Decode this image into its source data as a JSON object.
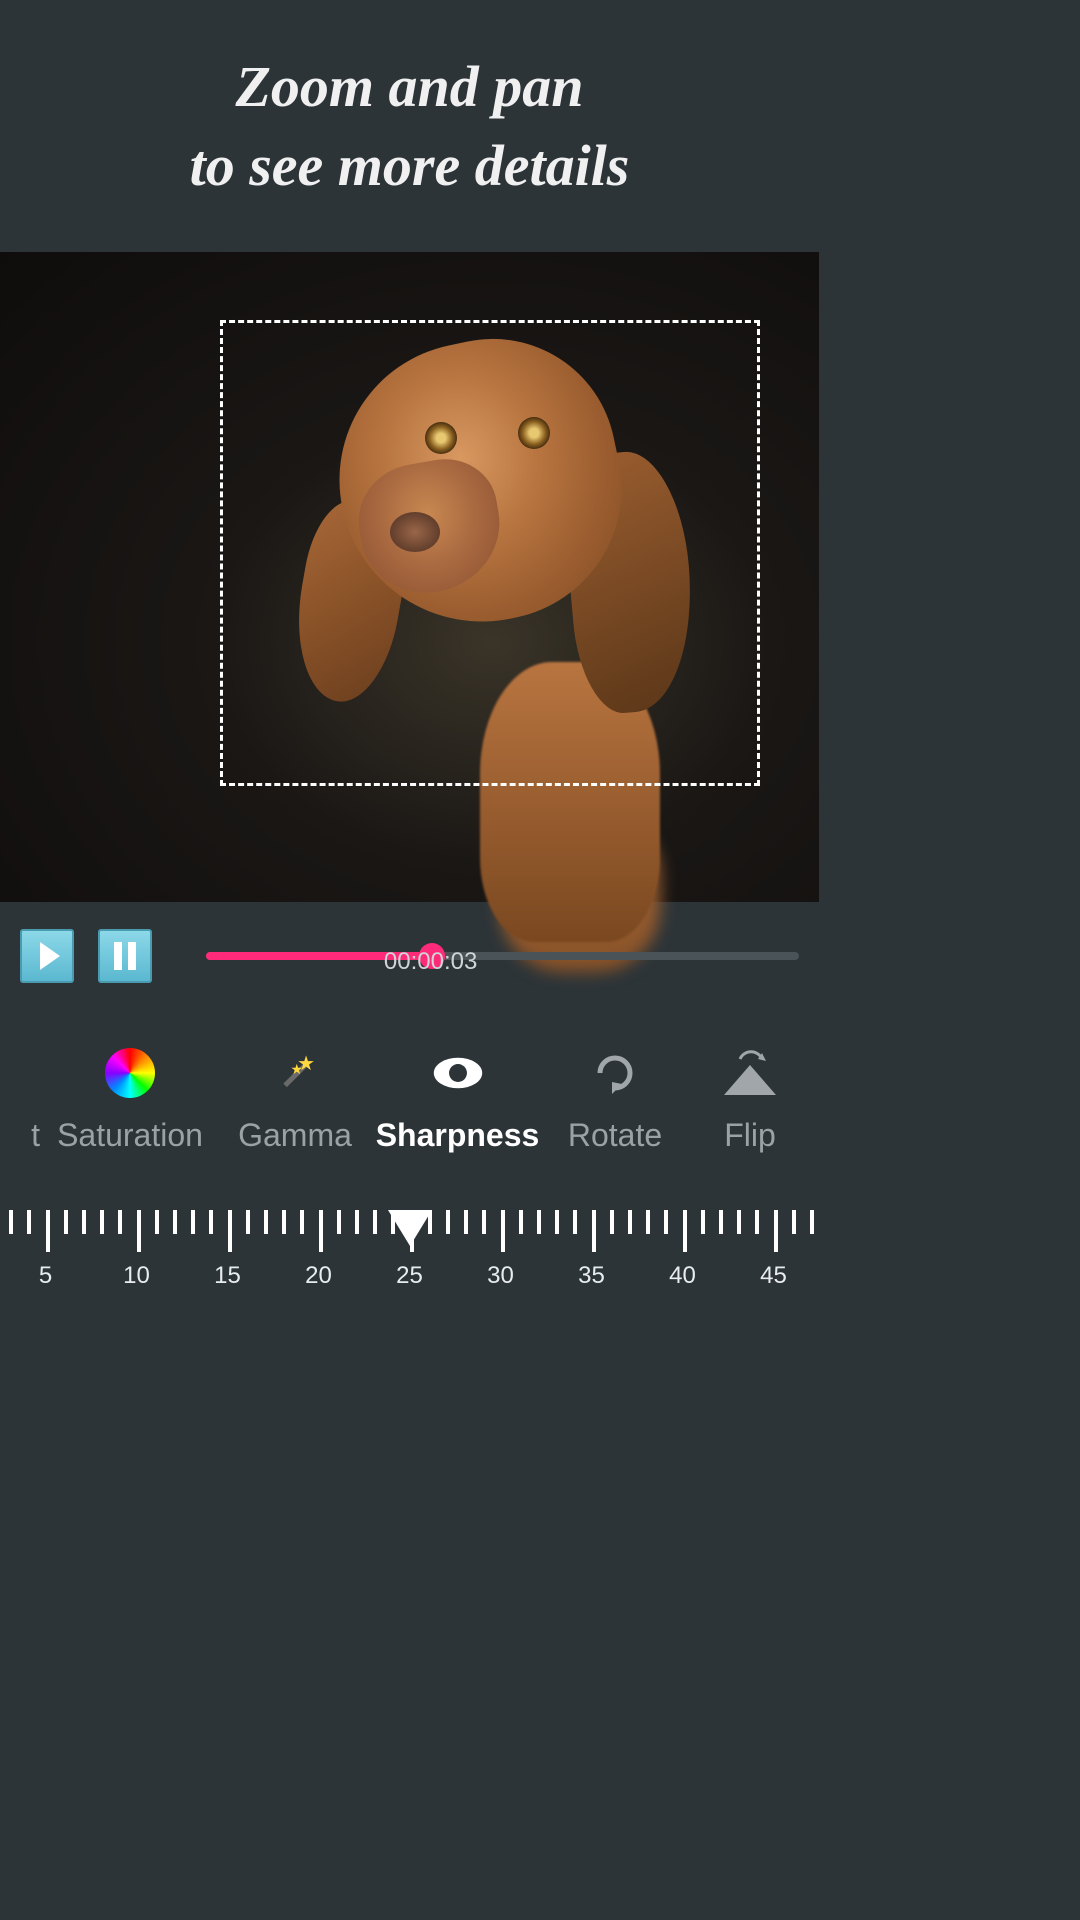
{
  "header": {
    "line1": "Zoom and pan",
    "line2": "to see more details"
  },
  "playback": {
    "timecode": "00:00:03",
    "progress_percent": 38
  },
  "tools": {
    "partial_left": "t",
    "items": [
      {
        "id": "saturation",
        "label": "Saturation",
        "active": false
      },
      {
        "id": "gamma",
        "label": "Gamma",
        "active": false
      },
      {
        "id": "sharpness",
        "label": "Sharpness",
        "active": true
      },
      {
        "id": "rotate",
        "label": "Rotate",
        "active": false
      },
      {
        "id": "flip",
        "label": "Flip",
        "active": false
      }
    ]
  },
  "ruler": {
    "min_visible": 5,
    "max_visible": 45,
    "major_step": 5,
    "current": 25,
    "labels": [
      "5",
      "10",
      "15",
      "20",
      "25",
      "30",
      "35",
      "40",
      "45"
    ]
  },
  "colors": {
    "accent": "#ff2b7a",
    "background": "#2c3438"
  }
}
